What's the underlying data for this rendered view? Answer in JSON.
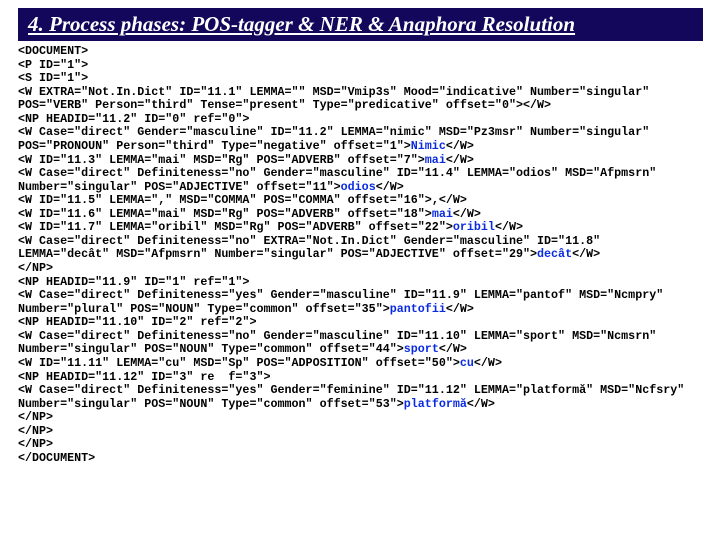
{
  "title": "4. Process phases: POS-tagger & NER & Anaphora Resolution",
  "w": {
    "nimic": "Nimic",
    "mai1": "mai",
    "odios": "odios",
    "mai2": "mai",
    "oribil": "oribil",
    "decat": "decât",
    "pantofii": "pantofii",
    "sport": "sport",
    "cu": "cu",
    "platforma": "platformă"
  },
  "L": {
    "l01": "<DOCUMENT>",
    "l02": "<P ID=\"1\">",
    "l03": "<S ID=\"1\">",
    "l04": "<W EXTRA=\"Not.In.Dict\" ID=\"11.1\" LEMMA=\"\" MSD=\"Vmip3s\" Mood=\"indicative\" Number=\"singular\" POS=\"VERB\" Person=\"third\" Tense=\"present\" Type=\"predicative\" offset=\"0\"></W>",
    "l05": "<NP HEADID=\"11.2\" ID=\"0\" ref=\"0\">",
    "l06a": "<W Case=\"direct\" Gender=\"masculine\" ID=\"11.2\" LEMMA=\"nimic\" MSD=\"Pz3msr\" Number=\"singular\" POS=\"PRONOUN\" Person=\"third\" Type=\"negative\" offset=\"1\">",
    "l06b": "</W>",
    "l07a": "<W ID=\"11.3\" LEMMA=\"mai\" MSD=\"Rg\" POS=\"ADVERB\" offset=\"7\">",
    "l07b": "</W>",
    "l08a": "<W Case=\"direct\" Definiteness=\"no\" Gender=\"masculine\" ID=\"11.4\" LEMMA=\"odios\" MSD=\"Afpmsrn\" Number=\"singular\" POS=\"ADJECTIVE\" offset=\"11\">",
    "l08b": "</W>",
    "l09a": "<W ID=\"11.5\" LEMMA=\",\" MSD=\"COMMA\" POS=\"COMMA\" offset=\"16\">",
    "l09b": ",</W>",
    "l10a": "<W ID=\"11.6\" LEMMA=\"mai\" MSD=\"Rg\" POS=\"ADVERB\" offset=\"18\">",
    "l10b": "</W>",
    "l11a": "<W ID=\"11.7\" LEMMA=\"oribil\" MSD=\"Rg\" POS=\"ADVERB\" offset=\"22\">",
    "l11b": "</W>",
    "l12a": "<W Case=\"direct\" Definiteness=\"no\" EXTRA=\"Not.In.Dict\" Gender=\"masculine\" ID=\"11.8\" LEMMA=\"decât\" MSD=\"Afpmsrn\" Number=\"singular\" POS=\"ADJECTIVE\" offset=\"29\">",
    "l12b": "</W>",
    "l13": "</NP>",
    "l14": "<NP HEADID=\"11.9\" ID=\"1\" ref=\"1\">",
    "l15a": "<W Case=\"direct\" Definiteness=\"yes\" Gender=\"masculine\" ID=\"11.9\" LEMMA=\"pantof\" MSD=\"Ncmpry\" Number=\"plural\" POS=\"NOUN\" Type=\"common\" offset=\"35\">",
    "l15b": "</W>",
    "l16": "<NP HEADID=\"11.10\" ID=\"2\" ref=\"2\">",
    "l17a": "<W Case=\"direct\" Definiteness=\"no\" Gender=\"masculine\" ID=\"11.10\" LEMMA=\"sport\" MSD=\"Ncmsrn\" Number=\"singular\" POS=\"NOUN\" Type=\"common\" offset=\"44\">",
    "l17b": "</W>",
    "l18a": "<W ID=\"11.11\" LEMMA=\"cu\" MSD=\"Sp\" POS=\"ADPOSITION\" offset=\"50\">",
    "l18b": "</W>",
    "l19": "<NP HEADID=\"11.12\" ID=\"3\" re  f=\"3\">",
    "l20a": "<W Case=\"direct\" Definiteness=\"yes\" Gender=\"feminine\" ID=\"11.12\" LEMMA=\"platformă\" MSD=\"Ncfsry\" Number=\"singular\" POS=\"NOUN\" Type=\"common\" offset=\"53\">",
    "l20b": "</W>",
    "l21": "</NP>",
    "l22": "</NP>",
    "l23": "</NP>",
    "l24": "</DOCUMENT>"
  }
}
